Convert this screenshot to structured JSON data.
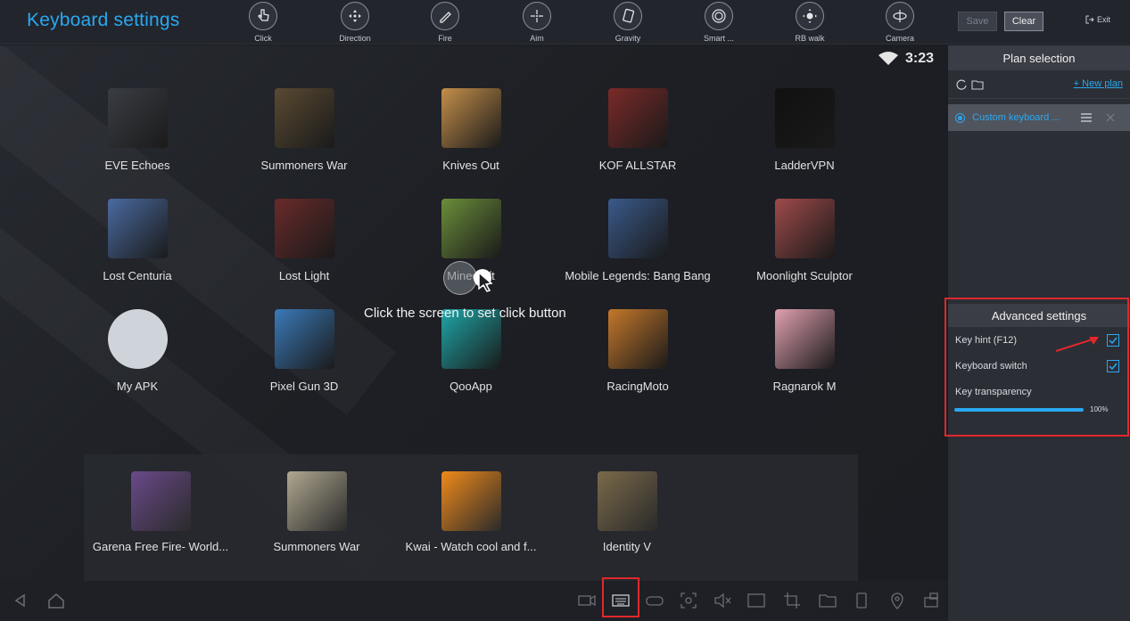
{
  "header": {
    "title": "Keyboard settings",
    "tools": [
      {
        "label": "Click",
        "icon": "hand-pointer-icon"
      },
      {
        "label": "Direction",
        "icon": "dpad-icon"
      },
      {
        "label": "Fire",
        "icon": "bullet-icon"
      },
      {
        "label": "Aim",
        "icon": "crosshair-icon"
      },
      {
        "label": "Gravity",
        "icon": "tilt-phone-icon"
      },
      {
        "label": "Smart ...",
        "icon": "smart-wheel-icon"
      },
      {
        "label": "RB walk",
        "icon": "joystick-icon"
      },
      {
        "label": "Camera",
        "icon": "camera-rotate-icon"
      }
    ],
    "save_label": "Save",
    "clear_label": "Clear",
    "exit_label": "Exit"
  },
  "status": {
    "time": "3:23"
  },
  "apps": [
    {
      "name": "EVE Echoes",
      "color": "#3a3d44"
    },
    {
      "name": "Summoners War",
      "color": "#5a4a32"
    },
    {
      "name": "Knives Out",
      "color": "#c48f4a"
    },
    {
      "name": "KOF ALLSTAR",
      "color": "#7a2a28"
    },
    {
      "name": "LadderVPN",
      "color": "#101010"
    },
    {
      "name": "Lost Centuria",
      "color": "#4a6aa0"
    },
    {
      "name": "Lost Light",
      "color": "#6a2a2a"
    },
    {
      "name": "Minecraft",
      "color": "#6b8e3a"
    },
    {
      "name": "Mobile Legends: Bang Bang",
      "color": "#3a5a8a"
    },
    {
      "name": "Moonlight Sculptor",
      "color": "#a04a4a"
    },
    {
      "name": "My APK",
      "color": "#cfd3da"
    },
    {
      "name": "Pixel Gun 3D",
      "color": "#3a7ab8"
    },
    {
      "name": "QooApp",
      "color": "#1fa6a8"
    },
    {
      "name": "RacingMoto",
      "color": "#c4782a"
    },
    {
      "name": "Ragnarok M",
      "color": "#e0a0b0"
    }
  ],
  "dock": [
    {
      "name": "Garena Free Fire- World...",
      "color": "#6a4a8a"
    },
    {
      "name": "Summoners War",
      "color": "#b0a890"
    },
    {
      "name": "Kwai - Watch cool and f...",
      "color": "#f08a1a"
    },
    {
      "name": "Identity V",
      "color": "#7a6a4a"
    }
  ],
  "click_hint": "Click the screen to set click button",
  "plan": {
    "title": "Plan selection",
    "new_plan": "+ New plan",
    "current": "Custom keyboard ..."
  },
  "advanced": {
    "title": "Advanced settings",
    "key_hint": "Key hint (F12)",
    "keyboard_switch": "Keyboard switch",
    "transparency_label": "Key transparency",
    "transparency_value": "100%",
    "transparency_level": 1.0,
    "key_hint_checked": true,
    "keyboard_switch_checked": true
  },
  "colors": {
    "accent": "#2aa8f2",
    "highlight": "#e0282d"
  }
}
